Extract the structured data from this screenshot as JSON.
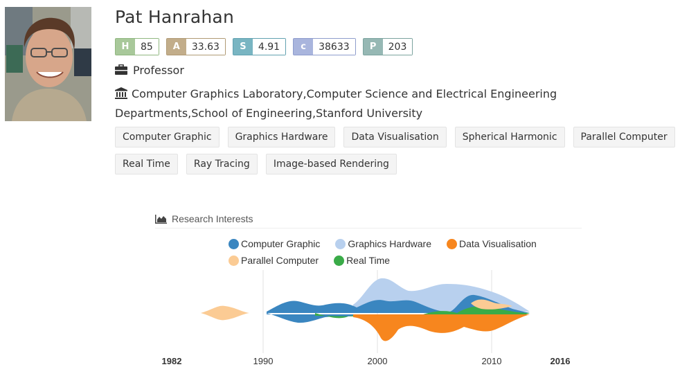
{
  "profile": {
    "name": "Pat Hanrahan",
    "position": "Professor",
    "affiliation": "Computer Graphics Laboratory,Computer Science and Electrical Engineering Departments,School of Engineering,Stanford University"
  },
  "metrics": [
    {
      "key": "H",
      "value": "85",
      "color": "#a8c89a",
      "border": "#8fb77f"
    },
    {
      "key": "A",
      "value": "33.63",
      "color": "#c2ad8a",
      "border": "#b09a74"
    },
    {
      "key": "S",
      "value": "4.91",
      "color": "#79b5c2",
      "border": "#61a1b0"
    },
    {
      "key": "c",
      "value": "38633",
      "color": "#a9b5dd",
      "border": "#8e9ccc"
    },
    {
      "key": "P",
      "value": "203",
      "color": "#96b8b4",
      "border": "#7ba39e"
    }
  ],
  "tags": [
    "Computer Graphic",
    "Graphics Hardware",
    "Data Visualisation",
    "Spherical Harmonic",
    "Parallel Computer",
    "Real Time",
    "Ray Tracing",
    "Image-based Rendering"
  ],
  "research": {
    "title": "Research Interests",
    "legend": [
      {
        "name": "Computer Graphic",
        "color": "#3a86c0"
      },
      {
        "name": "Graphics Hardware",
        "color": "#b8d0ee"
      },
      {
        "name": "Data Visualisation",
        "color": "#f7861e"
      },
      {
        "name": "Parallel Computer",
        "color": "#fbcb94"
      },
      {
        "name": "Real Time",
        "color": "#3aab48"
      }
    ]
  },
  "chart_data": {
    "type": "area",
    "x_ticks": [
      "1982",
      "1990",
      "2000",
      "2010",
      "2016"
    ],
    "x_range": [
      1982,
      2016
    ]
  }
}
